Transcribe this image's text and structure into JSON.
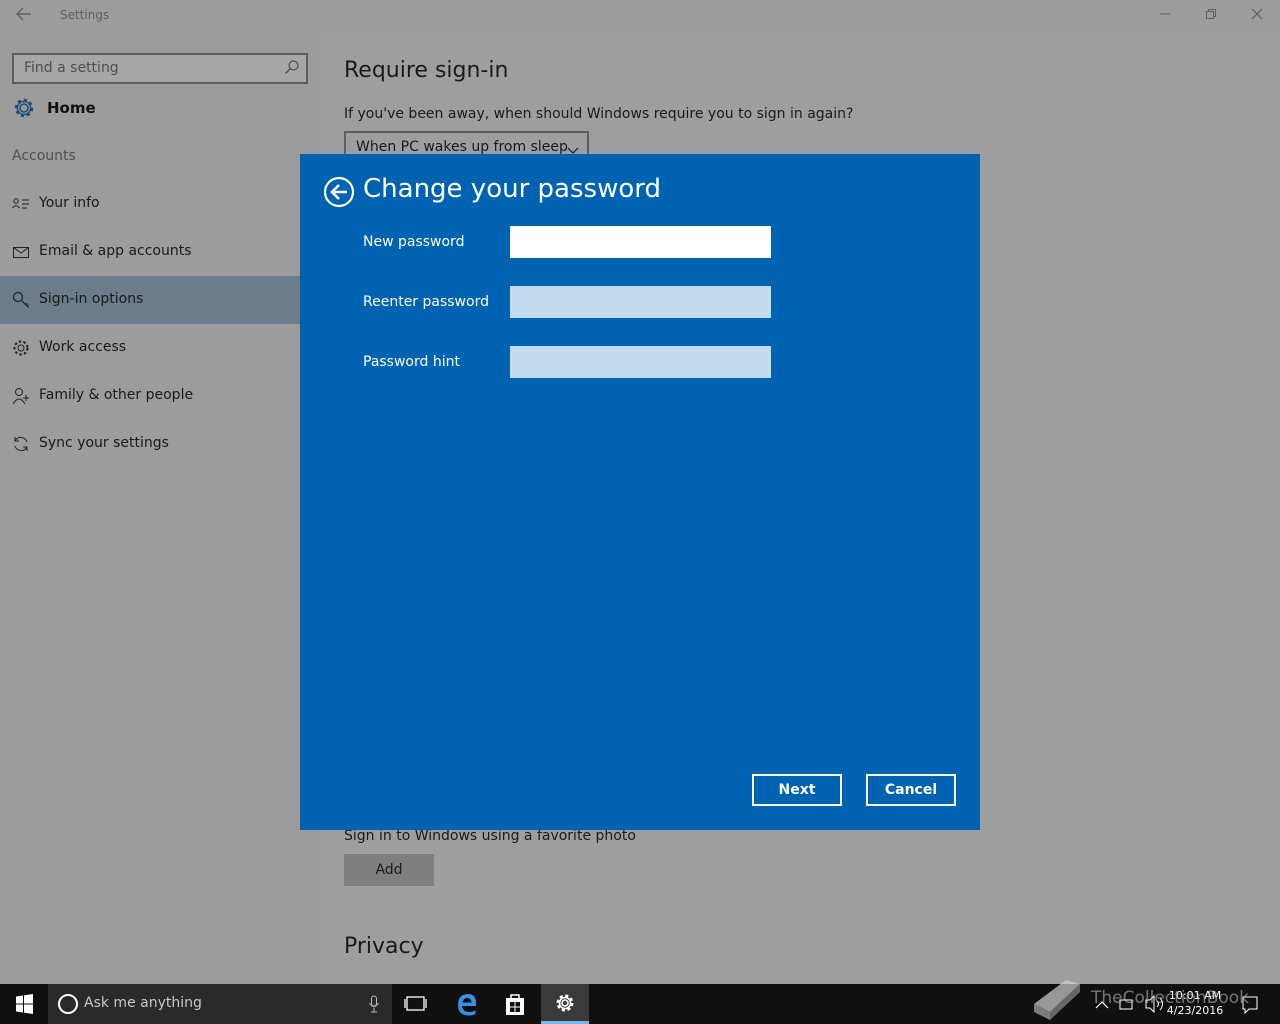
{
  "window": {
    "title": "Settings"
  },
  "sidebar": {
    "search_placeholder": "Find a setting",
    "home_label": "Home",
    "section_label": "Accounts",
    "items": [
      {
        "label": "Your info",
        "icon": "contact-card-icon",
        "selected": false
      },
      {
        "label": "Email & app accounts",
        "icon": "mail-icon",
        "selected": false
      },
      {
        "label": "Sign-in options",
        "icon": "key-icon",
        "selected": true
      },
      {
        "label": "Work access",
        "icon": "briefcase-gear-icon",
        "selected": false
      },
      {
        "label": "Family & other people",
        "icon": "person-add-icon",
        "selected": false
      },
      {
        "label": "Sync your settings",
        "icon": "sync-icon",
        "selected": false
      }
    ]
  },
  "main": {
    "require_heading": "Require sign-in",
    "require_question": "If you've been away, when should Windows require you to sign in again?",
    "require_dropdown_value": "When PC wakes up from sleep",
    "picture_password_text": "Sign in to Windows using a favorite photo",
    "add_button": "Add",
    "privacy_heading": "Privacy"
  },
  "dialog": {
    "title": "Change your password",
    "fields": [
      {
        "label": "New password",
        "value": "",
        "active": true
      },
      {
        "label": "Reenter password",
        "value": "",
        "active": false
      },
      {
        "label": "Password hint",
        "value": "",
        "active": false
      }
    ],
    "next_label": "Next",
    "cancel_label": "Cancel",
    "color": "#0063b1"
  },
  "taskbar": {
    "search_text": "Ask me anything",
    "time": "10:01 AM",
    "date": "4/23/2016",
    "watermark": "TheCollectionBook"
  }
}
